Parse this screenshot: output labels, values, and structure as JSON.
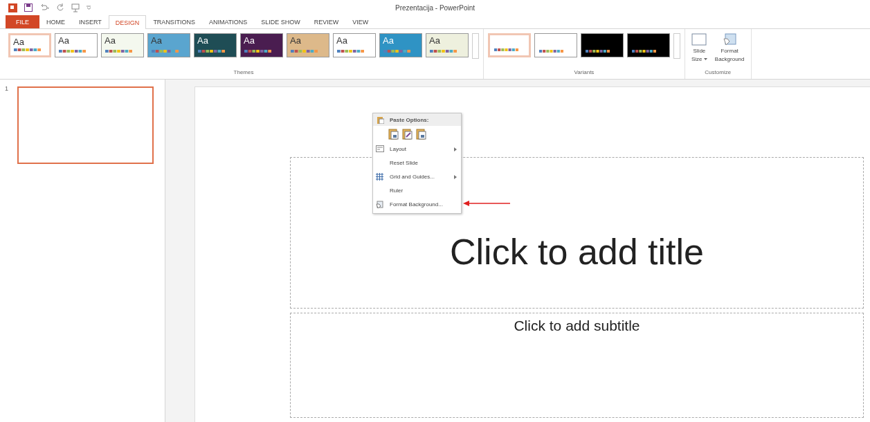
{
  "window": {
    "title": "Prezentacija - PowerPoint"
  },
  "tabs": [
    {
      "label": "FILE",
      "kind": "file",
      "selected": false
    },
    {
      "label": "HOME",
      "kind": "tab",
      "selected": false
    },
    {
      "label": "INSERT",
      "kind": "tab",
      "selected": false
    },
    {
      "label": "DESIGN",
      "kind": "tab",
      "selected": true
    },
    {
      "label": "TRANSITIONS",
      "kind": "tab",
      "selected": false
    },
    {
      "label": "ANIMATIONS",
      "kind": "tab",
      "selected": false
    },
    {
      "label": "SLIDE SHOW",
      "kind": "tab",
      "selected": false
    },
    {
      "label": "REVIEW",
      "kind": "tab",
      "selected": false
    },
    {
      "label": "VIEW",
      "kind": "tab",
      "selected": false
    }
  ],
  "themes": {
    "label": "Themes",
    "items": [
      {
        "label": "Aa",
        "color": "#ffffff",
        "selected": true
      },
      {
        "label": "Aa",
        "color": "#ffffff",
        "selected": false
      },
      {
        "label": "Aa",
        "color": "#f4f8ee",
        "selected": false
      },
      {
        "label": "Aa",
        "color": "#5aa5cf",
        "selected": false
      },
      {
        "label": "Aa",
        "color": "#1f4d55",
        "selected": false
      },
      {
        "label": "Aa",
        "color": "#4a1d50",
        "selected": false
      },
      {
        "label": "Aa",
        "color": "#ddb98a",
        "selected": false
      },
      {
        "label": "Aa",
        "color": "#ffffff",
        "selected": false
      },
      {
        "label": "Aa",
        "color": "#2f93c4",
        "selected": false
      },
      {
        "label": "Aa",
        "color": "#eef0de",
        "selected": false
      }
    ]
  },
  "variants": {
    "label": "Variants",
    "items": [
      {
        "color": "#ffffff",
        "selected": true
      },
      {
        "color": "#ffffff",
        "selected": false
      },
      {
        "color": "#000000",
        "selected": false
      },
      {
        "color": "#000000",
        "selected": false
      }
    ]
  },
  "customize": {
    "label": "Customize",
    "buttons": [
      {
        "kind": "slide-size",
        "line1": "Slide",
        "line2": "Size"
      },
      {
        "kind": "format-background",
        "line1": "Format",
        "line2": "Background"
      }
    ]
  },
  "slides": [
    {
      "number": "1",
      "selected": true
    }
  ],
  "slide": {
    "title_placeholder": "Click to add title",
    "subtitle_placeholder": "Click to add subtitle"
  },
  "context_menu": {
    "header": "Paste Options:",
    "items": [
      {
        "label": "Layout",
        "kind": "layout",
        "submenu": true
      },
      {
        "label": "Reset Slide",
        "kind": "none",
        "submenu": false
      },
      {
        "label": "Grid and Guides...",
        "kind": "grid",
        "submenu": true
      },
      {
        "label": "Ruler",
        "kind": "none",
        "submenu": false
      },
      {
        "label": "Format Background...",
        "kind": "background",
        "submenu": false
      }
    ]
  }
}
